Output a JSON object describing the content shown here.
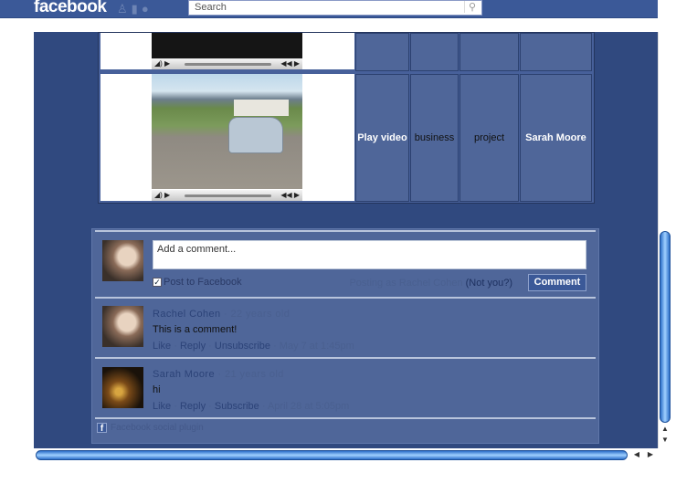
{
  "header": {
    "logo": "facebook",
    "search_placeholder": "Search",
    "icons": [
      "friends-icon",
      "messages-icon",
      "notifications-globe-icon",
      "search-icon"
    ]
  },
  "video_table": {
    "rows": [
      {
        "cells": [
          "",
          "",
          "",
          ""
        ]
      },
      {
        "cells": [
          "Play video",
          "business",
          "project",
          "Sarah Moore"
        ]
      }
    ]
  },
  "comments_widget": {
    "input_placeholder": "Add a comment...",
    "post_to_facebook": "Post to Facebook",
    "post_to_facebook_checked": true,
    "posting_as": "Posting as Rachel Cohen",
    "not_you": "(Not you?)",
    "comment_button": "Comment",
    "comments": [
      {
        "author": "Rachel Cohen",
        "age": "22 years old",
        "text": "This is a comment!",
        "actions": [
          "Like",
          "Reply",
          "Unsubscribe"
        ],
        "time": "May 7 at 1:45pm"
      },
      {
        "author": "Sarah Moore",
        "age": "21 years old",
        "text": "hi",
        "actions": [
          "Like",
          "Reply",
          "Subscribe"
        ],
        "time": "April 28 at 5:05pm"
      }
    ],
    "footer": "Facebook social plugin"
  }
}
